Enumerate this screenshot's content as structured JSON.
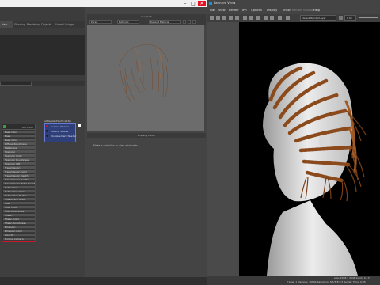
{
  "left_app": {
    "workspace_tabs": [
      "Shading",
      "Rendering",
      "Objects",
      "Unreal Bridge"
    ],
    "active_tab": "Hair",
    "graph_node": {
      "title": "aiStandardSurface",
      "header_label": "Out Color",
      "attributes": [
        "Base Color",
        "Base",
        "Base Color",
        "Diffuse Roughness",
        "Metalness",
        "Specular",
        "Specular Color",
        "Specular Roughness",
        "Specular IOR",
        "Transmission",
        "Transmission Color",
        "Transmission Depth",
        "Transmission Scatter",
        "Transmission Extra Roughness",
        "Subsurface",
        "Subsurface Color",
        "Subsurface Radius",
        "Subsurface Scale",
        "Coat",
        "Coat Color",
        "Coat Roughness",
        "Sheen",
        "Sheen Color",
        "Sheen Roughness",
        "Emission",
        "Emission Color",
        "Opacity",
        "Normal Camera"
      ]
    },
    "shading_group": {
      "title": "aiStandardSurface1SG",
      "rows": [
        "Surface Shader",
        "Volume Shader",
        "Displacement Shader"
      ]
    },
    "viewport": {
      "title": "Viewport",
      "toolbar": [
        "Persp",
        "Defaults",
        "Default Material"
      ]
    },
    "property_editor": {
      "title": "Property Editor",
      "empty_message": "Make a selection to view attributes."
    }
  },
  "render_view": {
    "title": "Render View",
    "menu": [
      "File",
      "View",
      "Render",
      "IPR",
      "Options",
      "Display",
      "Show",
      "Render Session",
      "Help"
    ],
    "layer": "defaultRenderLayer",
    "exposure": "0.00",
    "size_text": "size: 2048 x 2048  zoom: 0.172",
    "stats_text": "Frame: 1   Memory: 4989b   Sampling: 3/3/3/3/3/3   Render Time: 0:35"
  },
  "colors": {
    "node_border": "#c8182c",
    "sg_fill": "#2f3f7a",
    "hair": "#8a4a1c"
  }
}
